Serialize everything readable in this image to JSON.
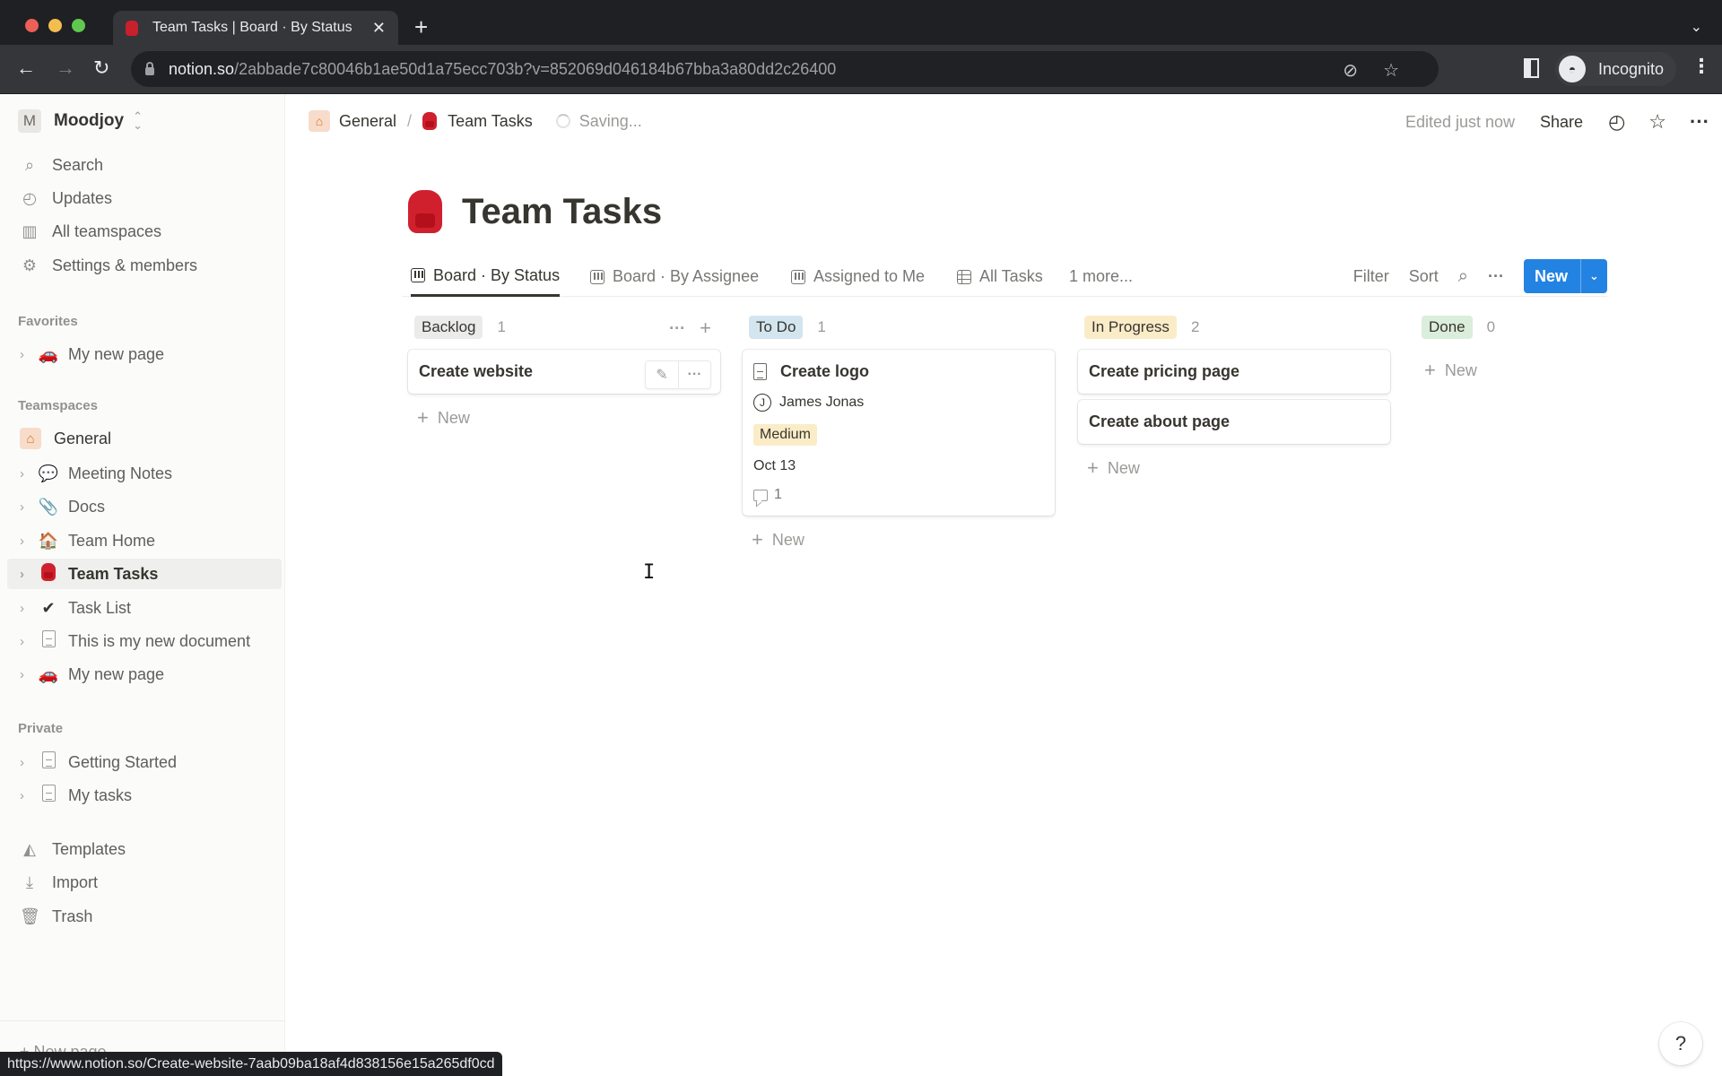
{
  "browser": {
    "tab_title": "Team Tasks | Board · By Status",
    "url_host": "notion.so",
    "url_path": "/2abbade7c80046b1ae50d1a75ecc703b?v=852069d046184b67bba3a80dd2c26400",
    "profile_label": "Incognito",
    "status_url": "https://www.notion.so/Create-website-7aab09ba18af4d838156e15a265df0cd"
  },
  "sidebar": {
    "workspace_initial": "M",
    "workspace_name": "Moodjoy",
    "nav": [
      {
        "label": "Search",
        "icon": "search-icon"
      },
      {
        "label": "Updates",
        "icon": "clock-icon"
      },
      {
        "label": "All teamspaces",
        "icon": "building-icon"
      },
      {
        "label": "Settings & members",
        "icon": "gear-icon"
      }
    ],
    "favorites_label": "Favorites",
    "favorites": [
      {
        "label": "My new page",
        "icon": "car-icon"
      }
    ],
    "teamspaces_label": "Teamspaces",
    "teamspace_general": "General",
    "teamspace_pages": [
      {
        "label": "Meeting Notes",
        "icon": "speech-bubble-icon"
      },
      {
        "label": "Docs",
        "icon": "paperclip-icon"
      },
      {
        "label": "Team Home",
        "icon": "house-icon"
      },
      {
        "label": "Team Tasks",
        "icon": "backpack-icon",
        "active": true
      },
      {
        "label": "Task List",
        "icon": "checkmark-icon"
      },
      {
        "label": "This is my new document",
        "icon": "document-icon"
      },
      {
        "label": "My new page",
        "icon": "car-icon"
      }
    ],
    "private_label": "Private",
    "private_pages": [
      {
        "label": "Getting Started",
        "icon": "document-icon"
      },
      {
        "label": "My tasks",
        "icon": "document-icon"
      }
    ],
    "footer": [
      {
        "label": "Templates",
        "icon": "templates-icon"
      },
      {
        "label": "Import",
        "icon": "import-icon"
      },
      {
        "label": "Trash",
        "icon": "trash-icon"
      }
    ],
    "new_page_label": "New page"
  },
  "topbar": {
    "breadcrumb": [
      "General",
      "Team Tasks"
    ],
    "saving_label": "Saving...",
    "edited_label": "Edited just now",
    "share_label": "Share"
  },
  "page": {
    "title": "Team Tasks",
    "views": [
      {
        "label": "Board · By Status",
        "icon": "board-icon",
        "active": true
      },
      {
        "label": "Board · By Assignee",
        "icon": "board-icon"
      },
      {
        "label": "Assigned to Me",
        "icon": "board-icon"
      },
      {
        "label": "All Tasks",
        "icon": "table-icon"
      }
    ],
    "more_views_label": "1 more...",
    "filter_label": "Filter",
    "sort_label": "Sort",
    "new_label": "New"
  },
  "board": {
    "new_card_label": "New",
    "columns": [
      {
        "name": "Backlog",
        "count": "1",
        "color": "#ebebea",
        "cards": [
          {
            "title": "Create website"
          }
        ]
      },
      {
        "name": "To Do",
        "count": "1",
        "color": "#d3e5ef",
        "cards": [
          {
            "title": "Create logo",
            "assignee_initial": "J",
            "assignee": "James Jonas",
            "priority": "Medium",
            "priority_color": "#fbecc8",
            "date": "Oct 13",
            "comments": "1"
          }
        ]
      },
      {
        "name": "In Progress",
        "count": "2",
        "color": "#fbecc8",
        "cards": [
          {
            "title": "Create pricing page"
          },
          {
            "title": "Create about page"
          }
        ]
      },
      {
        "name": "Done",
        "count": "0",
        "color": "#dbeddb",
        "cards": []
      }
    ]
  },
  "help_label": "?"
}
